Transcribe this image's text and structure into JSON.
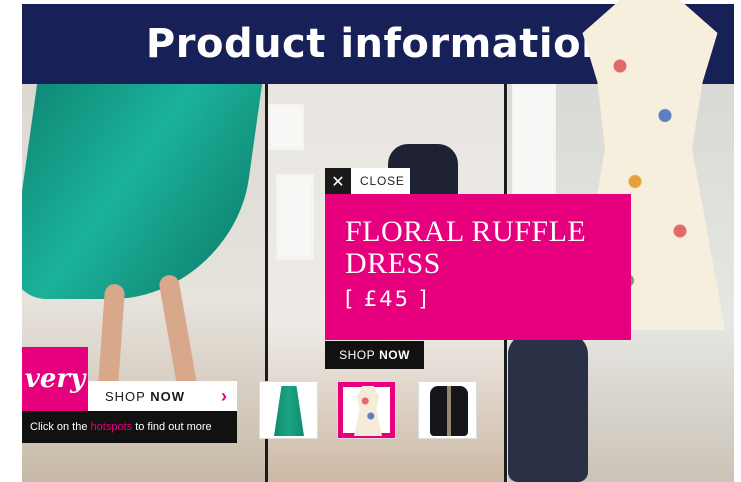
{
  "header": {
    "title": "Product information"
  },
  "popup": {
    "close_icon": "close-icon",
    "close_label": "CLOSE",
    "product_title": "FLORAL RUFFLE DRESS",
    "price": "[ £45 ]",
    "shop_now_prefix": "SHOP",
    "shop_now_bold": "NOW"
  },
  "promo": {
    "logo_text": "very",
    "shop_now_prefix": "SHOP",
    "shop_now_bold": "NOW",
    "arrow_icon": "chevron-right-icon",
    "hotspot_prefix": "Click on the",
    "hotspot_highlight": "hotspots",
    "hotspot_suffix": "to find out more"
  },
  "thumbnails": [
    {
      "name": "green pleated skirt"
    },
    {
      "name": "floral ruffle dress"
    },
    {
      "name": "black military jacket"
    }
  ],
  "colors": {
    "brand_pink": "#e6007e",
    "header_navy": "#172157"
  }
}
